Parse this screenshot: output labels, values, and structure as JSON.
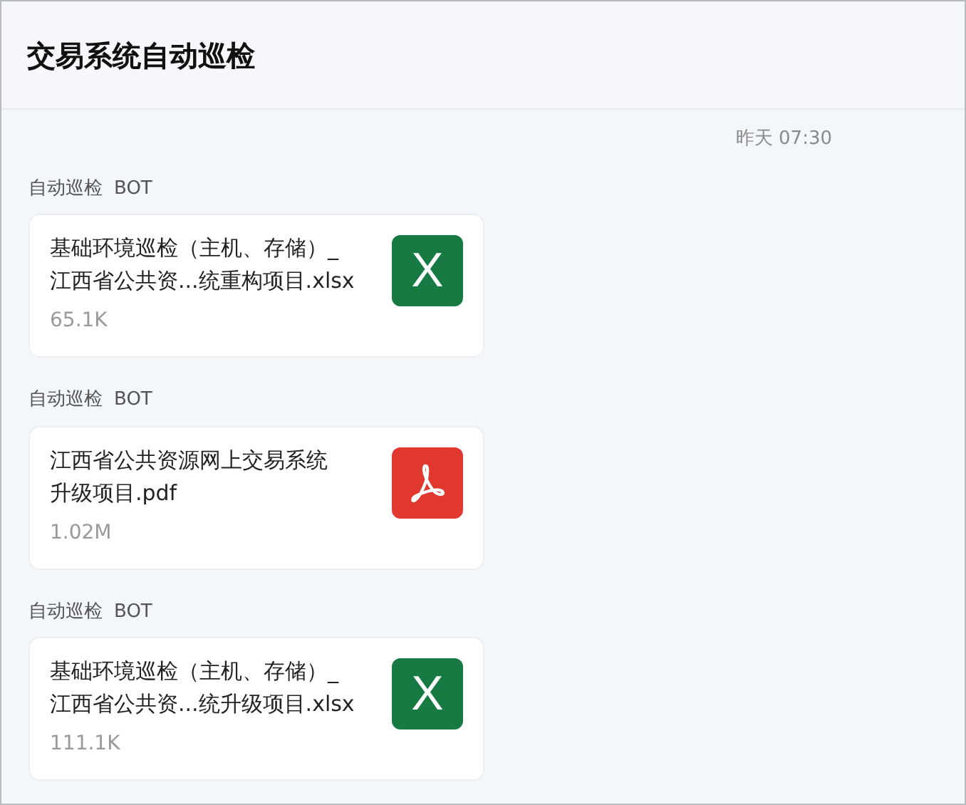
{
  "header": {
    "title": "交易系统自动巡检"
  },
  "timestamp": "昨天 07:30",
  "messages": [
    {
      "sender": "自动巡检",
      "sender_tag": "BOT",
      "file": {
        "name_lines": [
          "基础环境巡检（主机、存储）_",
          "江西省公共资...统重构项目.xlsx"
        ],
        "size": "65.1K",
        "kind": "xlsx",
        "icon_text": "X"
      }
    },
    {
      "sender": "自动巡检",
      "sender_tag": "BOT",
      "file": {
        "name_lines": [
          "江西省公共资源网上交易系统",
          "升级项目.pdf"
        ],
        "size": "1.02M",
        "kind": "pdf"
      }
    },
    {
      "sender": "自动巡检",
      "sender_tag": "BOT",
      "file": {
        "name_lines": [
          "基础环境巡检（主机、存储）_",
          "江西省公共资...统升级项目.xlsx"
        ],
        "size": "111.1K",
        "kind": "xlsx",
        "icon_text": "X"
      }
    }
  ]
}
